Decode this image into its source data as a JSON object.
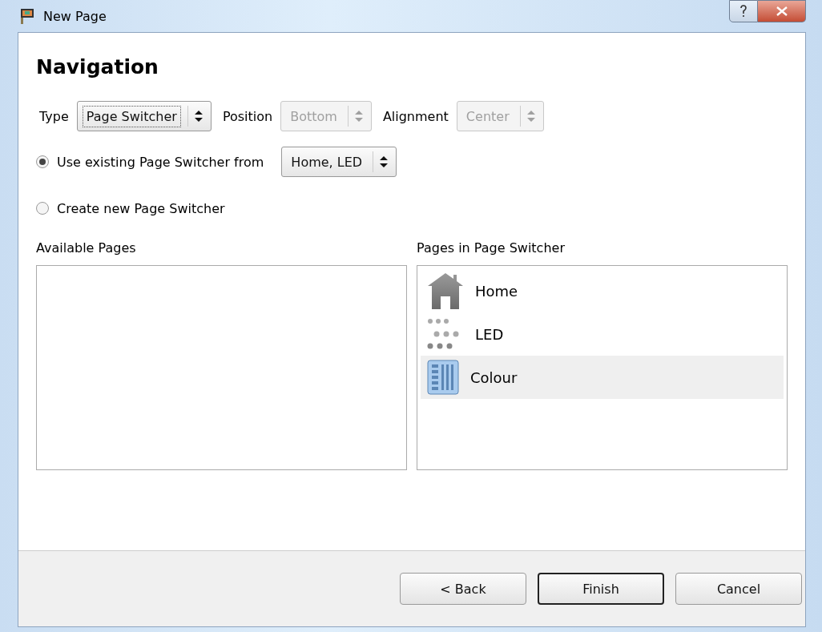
{
  "window": {
    "title": "New Page"
  },
  "heading": "Navigation",
  "selectors": [
    {
      "label": "Type",
      "value": "Page Switcher",
      "disabled": false,
      "focused": true
    },
    {
      "label": "Position",
      "value": "Bottom",
      "disabled": true,
      "focused": false
    },
    {
      "label": "Alignment",
      "value": "Center",
      "disabled": true,
      "focused": false
    }
  ],
  "options": [
    {
      "label": "Use existing Page Switcher from",
      "selected": true,
      "combo": {
        "value": "Home, LED",
        "disabled": false
      }
    },
    {
      "label": "Create new Page Switcher",
      "selected": false
    }
  ],
  "lists": [
    {
      "label": "Available Pages"
    },
    {
      "label": "Pages in Page Switcher",
      "items": [
        {
          "kind": "house",
          "label": "Home",
          "selected": false
        },
        {
          "kind": "dots",
          "label": "LED",
          "selected": false
        },
        {
          "kind": "columns",
          "label": "Colour",
          "selected": true
        }
      ]
    }
  ],
  "buttons": [
    {
      "label": "< Back",
      "default": false
    },
    {
      "label": "Finish",
      "default": true
    },
    {
      "label": "Cancel",
      "default": false
    }
  ]
}
